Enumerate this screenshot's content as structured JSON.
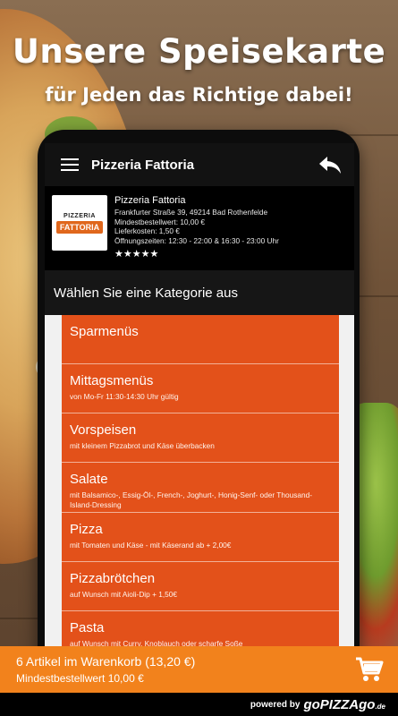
{
  "promo": {
    "headline": "Unsere Speisekarte",
    "subheadline": "für Jeden das Richtige dabei!"
  },
  "appbar": {
    "title": "Pizzeria Fattoria",
    "menu_icon": "hamburger-menu-icon",
    "back_icon": "reply-back-arrow-icon"
  },
  "restaurant": {
    "logo_top": "PIZZERIA",
    "logo_main": "FATTORIA",
    "name": "Pizzeria Fattoria",
    "address": "Frankfurter Straße 39, 49214 Bad Rothenfelde",
    "min_order": "Mindestbestellwert: 10,00 €",
    "delivery": "Lieferkosten: 1,50 €",
    "hours": "Öffnungszeiten: 12:30 - 22:00 & 16:30 - 23:00 Uhr",
    "stars": "★★★★★"
  },
  "category_header": "Wählen Sie eine Kategorie aus",
  "categories": [
    {
      "title": "Sparmenüs",
      "desc": ""
    },
    {
      "title": "Mittagsmenüs",
      "desc": "von Mo-Fr 11:30-14:30 Uhr gültig"
    },
    {
      "title": "Vorspeisen",
      "desc": "mit kleinem Pizzabrot und Käse überbacken"
    },
    {
      "title": "Salate",
      "desc": "mit Balsamico-, Essig-Öl-, French-, Joghurt-, Honig-Senf- oder Thousand-Island-Dressing"
    },
    {
      "title": "Pizza",
      "desc": "mit Tomaten und Käse - mit Käserand ab + 2,00€"
    },
    {
      "title": "Pizzabrötchen",
      "desc": "auf Wunsch mit Aioli-Dip + 1,50€"
    },
    {
      "title": "Pasta",
      "desc": "auf Wunsch mit Curry, Knoblauch oder scharfe Soße"
    }
  ],
  "cart": {
    "main": "6 Artikel im Warenkorb (13,20 €)",
    "min": "Mindestbestellwert 10,00 €",
    "icon": "shopping-cart-icon"
  },
  "footer": {
    "powered": "powered by",
    "brand_go": "go",
    "brand_pizza": "PIZZA",
    "brand_go2": "go",
    "brand_tld": ".de"
  },
  "colors": {
    "card_orange": "#e3511a",
    "cart_orange": "#f2821c",
    "appbar": "#121212"
  }
}
